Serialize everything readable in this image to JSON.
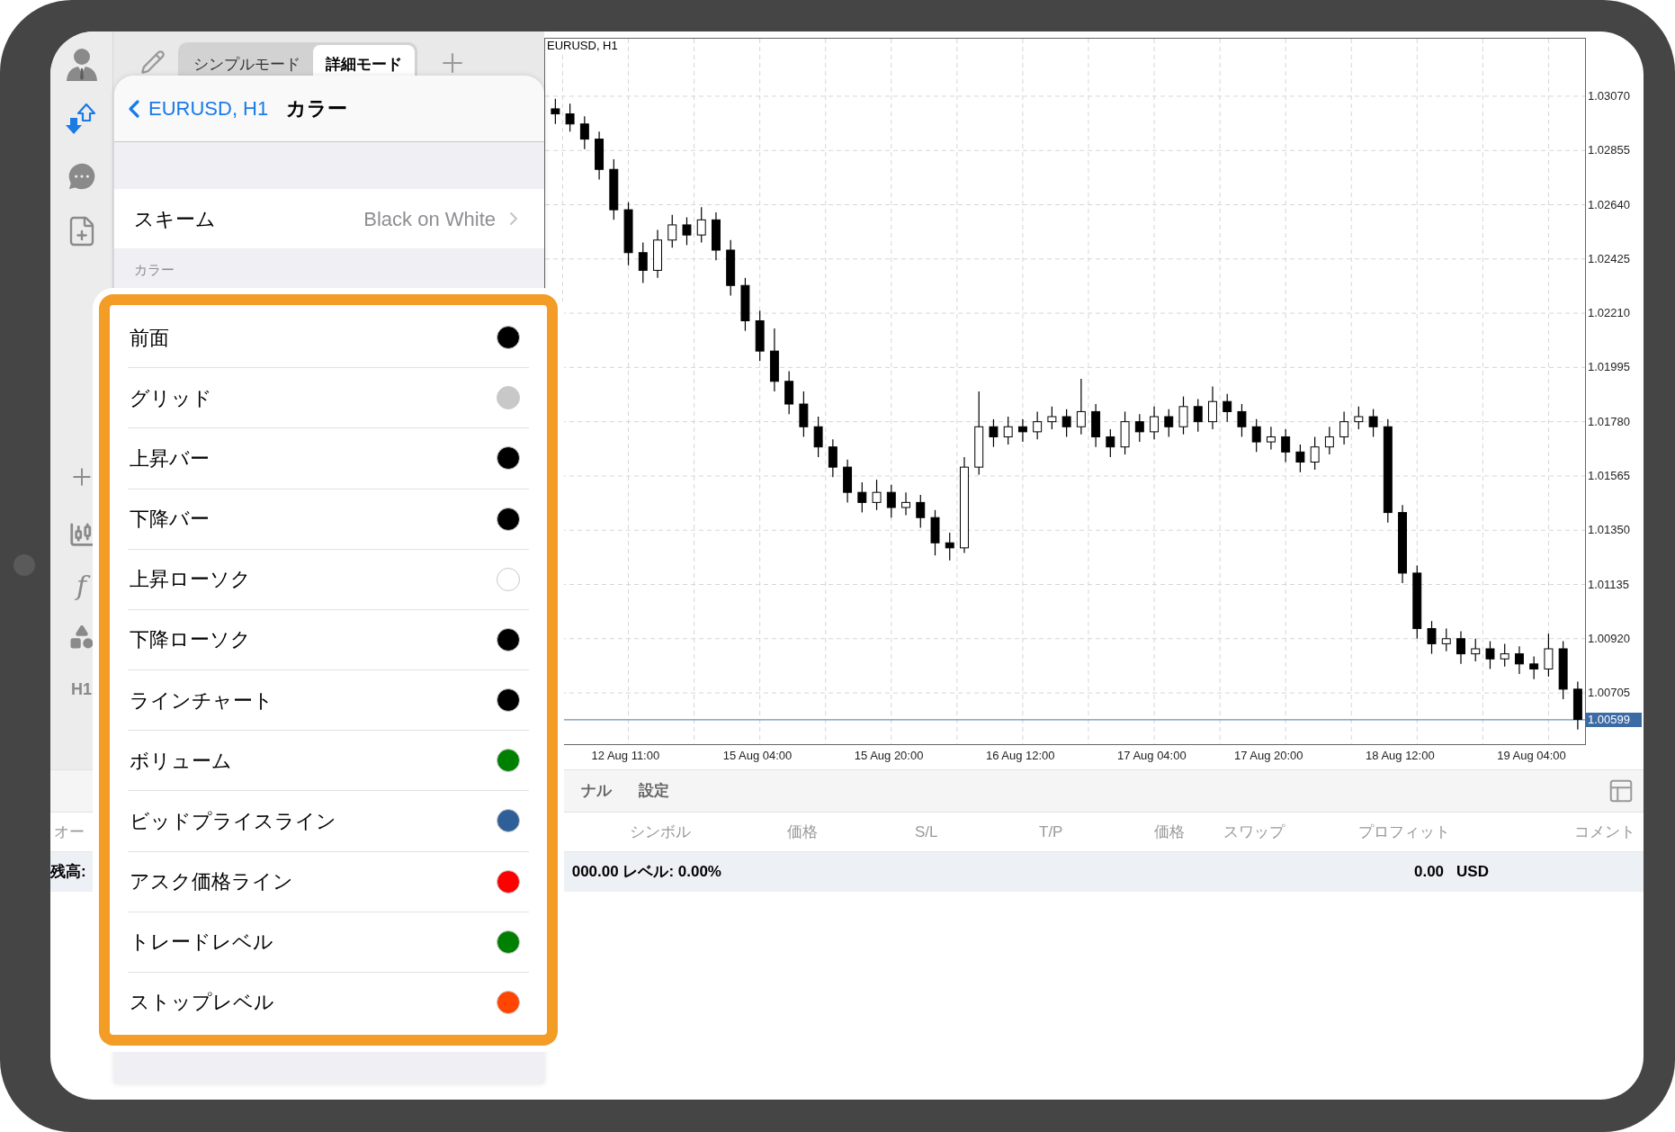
{
  "sidebar": {
    "indicator_glyph": "f",
    "timeframe": "H1"
  },
  "mode_tabs": [
    {
      "label": "シンプルモード",
      "selected": false
    },
    {
      "label": "詳細モード",
      "selected": true
    }
  ],
  "settings_panel": {
    "back_label": "EURUSD, H1",
    "title": "カラー",
    "scheme": {
      "label": "スキーム",
      "value": "Black on White"
    },
    "section_label": "カラー",
    "colors": [
      {
        "label": "前面",
        "color": "#000000"
      },
      {
        "label": "グリッド",
        "color": "#c8c8c8"
      },
      {
        "label": "上昇バー",
        "color": "#000000"
      },
      {
        "label": "下降バー",
        "color": "#000000"
      },
      {
        "label": "上昇ローソク",
        "color": "#ffffff"
      },
      {
        "label": "下降ローソク",
        "color": "#000000"
      },
      {
        "label": "ラインチャート",
        "color": "#000000"
      },
      {
        "label": "ボリューム",
        "color": "#008000"
      },
      {
        "label": "ビッドプライスライン",
        "color": "#2f5f98"
      },
      {
        "label": "アスク価格ライン",
        "color": "#ff0000"
      },
      {
        "label": "トレードレベル",
        "color": "#008000"
      },
      {
        "label": "ストップレベル",
        "color": "#ff4500"
      }
    ]
  },
  "chart": {
    "symbol_label": "EURUSD, H1",
    "chart_data": {
      "type": "candlestick",
      "categories": [
        null,
        null,
        null,
        null,
        null,
        "12 Aug 11:00",
        null,
        null,
        null,
        null,
        null,
        null,
        null,
        null,
        "15 Aug 04:00",
        null,
        null,
        null,
        null,
        null,
        null,
        null,
        null,
        "15 Aug 20:00",
        null,
        null,
        null,
        null,
        null,
        null,
        null,
        null,
        "16 Aug 12:00",
        null,
        null,
        null,
        null,
        null,
        null,
        null,
        null,
        "17 Aug 04:00",
        null,
        null,
        null,
        null,
        null,
        null,
        null,
        "17 Aug 20:00",
        null,
        null,
        null,
        null,
        null,
        null,
        null,
        null,
        "18 Aug 12:00",
        null,
        null,
        null,
        null,
        null,
        null,
        null,
        null,
        "19 Aug 04:00",
        null,
        null,
        null
      ],
      "ohlc": [
        [
          1.0302,
          1.0306,
          1.0296,
          1.03
        ],
        [
          1.03,
          1.0304,
          1.0293,
          1.0296
        ],
        [
          1.0296,
          1.0299,
          1.0286,
          1.029
        ],
        [
          1.029,
          1.0293,
          1.0274,
          1.0278
        ],
        [
          1.0278,
          1.0282,
          1.0258,
          1.0262
        ],
        [
          1.0262,
          1.0265,
          1.024,
          1.0245
        ],
        [
          1.0245,
          1.0249,
          1.0233,
          1.0238
        ],
        [
          1.0238,
          1.0254,
          1.0235,
          1.025
        ],
        [
          1.025,
          1.026,
          1.0247,
          1.0256
        ],
        [
          1.0256,
          1.0259,
          1.0248,
          1.0252
        ],
        [
          1.0252,
          1.0263,
          1.0249,
          1.0258
        ],
        [
          1.0258,
          1.0261,
          1.0242,
          1.0246
        ],
        [
          1.0246,
          1.025,
          1.0228,
          1.0232
        ],
        [
          1.0232,
          1.0235,
          1.0214,
          1.0218
        ],
        [
          1.0218,
          1.0222,
          1.0202,
          1.0206
        ],
        [
          1.0206,
          1.0215,
          1.019,
          1.0194
        ],
        [
          1.0194,
          1.0198,
          1.0181,
          1.0185
        ],
        [
          1.0185,
          1.019,
          1.0172,
          1.0176
        ],
        [
          1.0176,
          1.018,
          1.0164,
          1.0168
        ],
        [
          1.0168,
          1.0171,
          1.0156,
          1.016
        ],
        [
          1.016,
          1.0163,
          1.0146,
          1.015
        ],
        [
          1.015,
          1.0154,
          1.0142,
          1.0146
        ],
        [
          1.0146,
          1.0155,
          1.0143,
          1.015
        ],
        [
          1.015,
          1.0153,
          1.014,
          1.0144
        ],
        [
          1.0144,
          1.015,
          1.0141,
          1.0146
        ],
        [
          1.0146,
          1.0149,
          1.0136,
          1.014
        ],
        [
          1.014,
          1.0143,
          1.0125,
          1.013
        ],
        [
          1.013,
          1.0134,
          1.0123,
          1.0128
        ],
        [
          1.0128,
          1.0164,
          1.0126,
          1.016
        ],
        [
          1.016,
          1.019,
          1.0157,
          1.0176
        ],
        [
          1.0176,
          1.0179,
          1.0168,
          1.0172
        ],
        [
          1.0172,
          1.018,
          1.0169,
          1.0176
        ],
        [
          1.0176,
          1.0179,
          1.017,
          1.0174
        ],
        [
          1.0174,
          1.0182,
          1.0171,
          1.0178
        ],
        [
          1.0178,
          1.0184,
          1.0175,
          1.018
        ],
        [
          1.018,
          1.0183,
          1.0172,
          1.0176
        ],
        [
          1.0176,
          1.0195,
          1.0173,
          1.0182
        ],
        [
          1.0182,
          1.0185,
          1.0168,
          1.0172
        ],
        [
          1.0172,
          1.0175,
          1.0164,
          1.0168
        ],
        [
          1.0168,
          1.0182,
          1.0165,
          1.0178
        ],
        [
          1.0178,
          1.0181,
          1.017,
          1.0174
        ],
        [
          1.0174,
          1.0184,
          1.0171,
          1.018
        ],
        [
          1.018,
          1.0183,
          1.0172,
          1.0176
        ],
        [
          1.0176,
          1.0188,
          1.0173,
          1.0184
        ],
        [
          1.0184,
          1.0187,
          1.0174,
          1.0178
        ],
        [
          1.0178,
          1.0192,
          1.0175,
          1.0186
        ],
        [
          1.0186,
          1.0189,
          1.0178,
          1.0182
        ],
        [
          1.0182,
          1.0185,
          1.0172,
          1.0176
        ],
        [
          1.0176,
          1.0179,
          1.0166,
          1.017
        ],
        [
          1.017,
          1.0176,
          1.0167,
          1.0172
        ],
        [
          1.0172,
          1.0175,
          1.0162,
          1.0166
        ],
        [
          1.0166,
          1.0169,
          1.0158,
          1.0162
        ],
        [
          1.0162,
          1.0172,
          1.0159,
          1.0168
        ],
        [
          1.0168,
          1.0176,
          1.0165,
          1.0172
        ],
        [
          1.0172,
          1.0182,
          1.0169,
          1.0178
        ],
        [
          1.0178,
          1.0184,
          1.0175,
          1.018
        ],
        [
          1.018,
          1.0183,
          1.0172,
          1.0176
        ],
        [
          1.0176,
          1.0179,
          1.0138,
          1.0142
        ],
        [
          1.0142,
          1.0145,
          1.0114,
          1.0118
        ],
        [
          1.0118,
          1.0121,
          1.0092,
          1.0096
        ],
        [
          1.0096,
          1.0099,
          1.0086,
          1.009
        ],
        [
          1.009,
          1.0096,
          1.0087,
          1.0092
        ],
        [
          1.0092,
          1.0095,
          1.0082,
          1.0086
        ],
        [
          1.0086,
          1.0092,
          1.0083,
          1.0088
        ],
        [
          1.0088,
          1.0091,
          1.008,
          1.0084
        ],
        [
          1.0084,
          1.009,
          1.0081,
          1.0086
        ],
        [
          1.0086,
          1.0089,
          1.0078,
          1.0082
        ],
        [
          1.0082,
          1.0085,
          1.0076,
          1.008
        ],
        [
          1.008,
          1.0094,
          1.0077,
          1.0088
        ],
        [
          1.0088,
          1.0091,
          1.0068,
          1.0072
        ],
        [
          1.0072,
          1.0075,
          1.0056,
          1.006
        ]
      ],
      "ylim": [
        1.00502,
        1.03298
      ],
      "grid": true,
      "ref_lines": [
        {
          "axis": "y",
          "value": 1.00599,
          "label": "1.00599",
          "color": "#6a8fb8"
        }
      ],
      "yticks": [
        {
          "value": 1.0307,
          "label": "1.03070"
        },
        {
          "value": 1.02855,
          "label": "1.02855"
        },
        {
          "value": 1.0264,
          "label": "1.02640"
        },
        {
          "value": 1.02425,
          "label": "1.02425"
        },
        {
          "value": 1.0221,
          "label": "1.02210"
        },
        {
          "value": 1.01995,
          "label": "1.01995"
        },
        {
          "value": 1.0178,
          "label": "1.01780"
        },
        {
          "value": 1.01565,
          "label": "1.01565"
        },
        {
          "value": 1.0135,
          "label": "1.01350"
        },
        {
          "value": 1.01135,
          "label": "1.01135"
        },
        {
          "value": 1.0092,
          "label": "1.00920"
        },
        {
          "value": 1.00705,
          "label": "1.00705"
        }
      ]
    }
  },
  "bottom_panel": {
    "tabs": [
      "ナル",
      "設定"
    ],
    "columns": [
      "オー",
      "シンボル",
      "価格",
      "S/L",
      "T/P",
      "価格",
      "スワップ",
      "プロフィット",
      "コメント"
    ],
    "balance_row": {
      "label": "残高:",
      "summary": "000.00 レベル: 0.00%",
      "profit": "0.00",
      "currency": "USD"
    }
  }
}
